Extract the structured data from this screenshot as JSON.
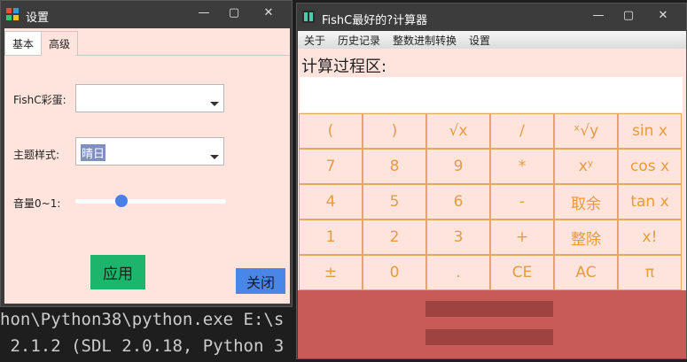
{
  "console": {
    "line1": "hon\\Python38\\python.exe E:\\s",
    "line2": " 2.1.2 (SDL 2.0.18, Python 3"
  },
  "settings": {
    "title": "设置",
    "tabs": [
      "基本",
      "高级"
    ],
    "easter_egg_label": "FishC彩蛋:",
    "easter_egg_value": "",
    "theme_label": "主题样式:",
    "theme_value": "晴日",
    "volume_label": "音量0~1:",
    "volume_value": 0.3,
    "apply_label": "应用",
    "close_label": "关闭"
  },
  "calc": {
    "title": "FishC最好的?计算器",
    "menu": [
      "关于",
      "历史记录",
      "整数进制转换",
      "设置"
    ],
    "process_label": "计算过程区:",
    "process_value": "",
    "keys": [
      [
        "(",
        ")",
        "√x",
        "/",
        "ˣ√y",
        "sin x"
      ],
      [
        "7",
        "8",
        "9",
        "*",
        "xʸ",
        "cos x"
      ],
      [
        "4",
        "5",
        "6",
        "-",
        "取余",
        "tan x"
      ],
      [
        "1",
        "2",
        "3",
        "+",
        "整除",
        "x!"
      ],
      [
        "±",
        "0",
        ".",
        "CE",
        "AC",
        "π"
      ]
    ]
  },
  "colors": {
    "panel_bg": "#fee4dc",
    "key_text": "#e89a3e",
    "bottom_panel": "#c85b58",
    "apply_button": "#1cb56b",
    "close_button": "#4a86e8"
  }
}
